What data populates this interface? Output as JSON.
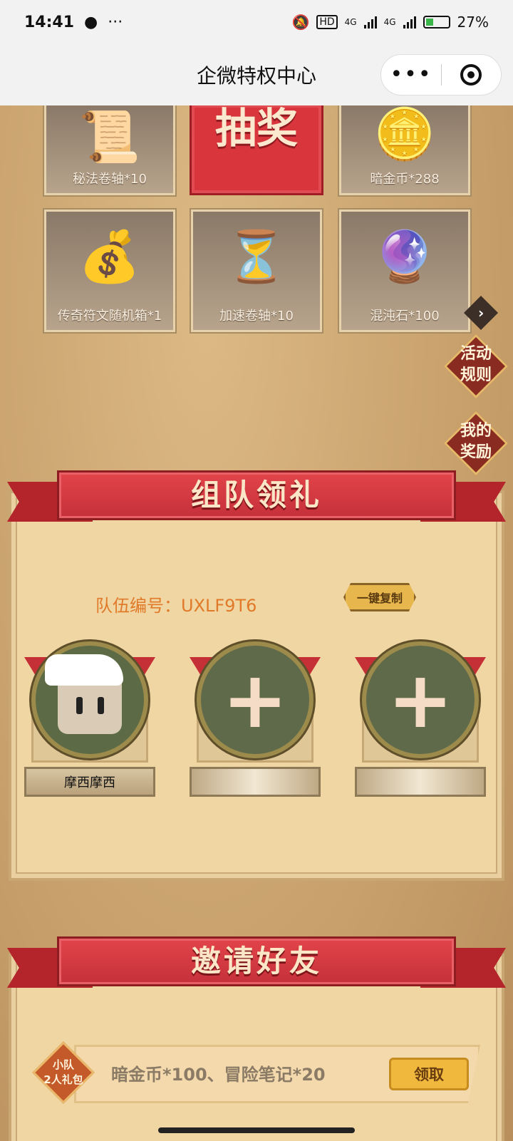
{
  "status_bar": {
    "time": "14:41",
    "network_1": "4G",
    "network_2": "4G",
    "battery": "27%"
  },
  "header": {
    "title": "企微特权中心"
  },
  "prizes": [
    {
      "label": "秘法卷轴*10",
      "icon": "scroll-icon"
    },
    {
      "label": "暗金币*288",
      "icon": "dark-gold-coin-icon"
    },
    {
      "label": "传奇符文随机箱*1",
      "icon": "rune-bag-icon"
    },
    {
      "label": "加速卷轴*10",
      "icon": "speed-scroll-icon"
    },
    {
      "label": "混沌石*100",
      "icon": "chaos-stone-icon"
    }
  ],
  "draw_button": "抽奖",
  "side": {
    "rules": "活动\n规则",
    "rewards": "我的\n奖励"
  },
  "team": {
    "title": "组队领礼",
    "team_number": "队伍编号：UXLF9T6",
    "copy_label": "一键复制",
    "members": [
      {
        "name": "摩西摩西"
      },
      {
        "name": ""
      },
      {
        "name": ""
      }
    ]
  },
  "invite": {
    "title": "邀请好友",
    "badge": "小队\n2人礼包",
    "reward": "暗金币*100、冒险笔记*20",
    "claim_label": "领取"
  }
}
